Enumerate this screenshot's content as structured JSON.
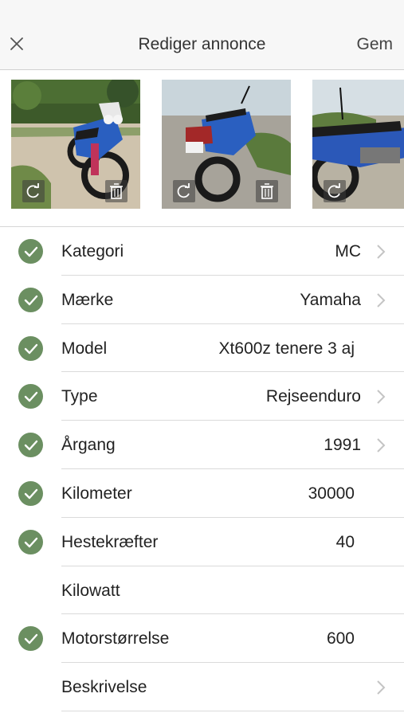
{
  "header": {
    "title": "Rediger annonce",
    "save_label": "Gem",
    "close_icon": "close-icon"
  },
  "photos": [
    {
      "name": "photo-1",
      "rotate_icon": "rotate-icon",
      "delete_icon": "trash-icon"
    },
    {
      "name": "photo-2",
      "rotate_icon": "rotate-icon",
      "delete_icon": "trash-icon"
    },
    {
      "name": "photo-3",
      "rotate_icon": "rotate-icon",
      "delete_icon": "trash-icon"
    }
  ],
  "fields": [
    {
      "label": "Kategori",
      "value": "MC",
      "checked": true,
      "chevron": true
    },
    {
      "label": "Mærke",
      "value": "Yamaha",
      "checked": true,
      "chevron": true
    },
    {
      "label": "Model",
      "value": "Xt600z tenere 3 aj",
      "checked": true,
      "chevron": false
    },
    {
      "label": "Type",
      "value": "Rejseenduro",
      "checked": true,
      "chevron": true
    },
    {
      "label": "Årgang",
      "value": "1991",
      "checked": true,
      "chevron": true
    },
    {
      "label": "Kilometer",
      "value": "30000",
      "checked": true,
      "chevron": false
    },
    {
      "label": "Hestekræfter",
      "value": "40",
      "checked": true,
      "chevron": false
    },
    {
      "label": "Kilowatt",
      "value": "",
      "checked": false,
      "chevron": false
    },
    {
      "label": "Motorstørrelse",
      "value": "600",
      "checked": true,
      "chevron": false
    },
    {
      "label": "Beskrivelse",
      "value": "",
      "checked": false,
      "chevron": true
    }
  ],
  "colors": {
    "check_green": "#6b8f61",
    "chevron_gray": "#c4c4c4",
    "separator": "#dadada"
  }
}
